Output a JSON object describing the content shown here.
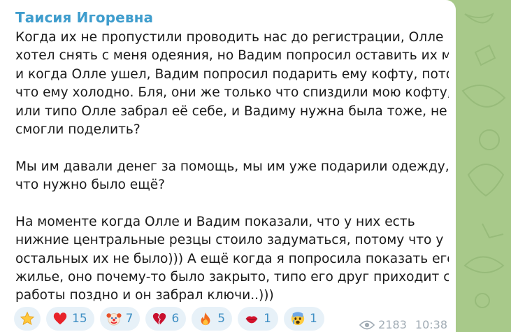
{
  "message": {
    "sender": "Таисия Игоревна",
    "lines": [
      "Когда их не пропустили проводить нас до регистрации, Олле",
      "хотел снять с меня одеяния, но Вадим попросил оставить их мне",
      "и когда Олле ушел, Вадим попросил подарить ему кофту, потому",
      "что ему холодно. Бля, они же только что спиздили мою кофту,",
      "или типо Олле забрал её себе, и Вадиму нужна была тоже, не",
      "смогли поделить?",
      "",
      "Мы им давали денег за помощь, мы им уже подарили одежду,",
      "что нужно было ещё?",
      "",
      "На моменте когда Олле и Вадим показали, что у них есть",
      "нижние центральные резцы стоило задуматься, потому что у",
      "остальных их не было))) А ещё когда я попросила показать его",
      "жилье, оно почему-то было закрыто, типо его друг приходит с",
      "работы поздно и он забрал ключи..)))"
    ],
    "views": "2183",
    "time": "10:38"
  },
  "reactions": [
    {
      "icon": "star-icon",
      "count": ""
    },
    {
      "icon": "heart-icon",
      "count": "15"
    },
    {
      "icon": "clown-icon",
      "count": "7"
    },
    {
      "icon": "broken-heart-icon",
      "count": "6"
    },
    {
      "icon": "fire-icon",
      "count": "5"
    },
    {
      "icon": "kiss-lips-icon",
      "count": "1"
    },
    {
      "icon": "crying-face-icon",
      "count": "1"
    }
  ],
  "colors": {
    "background": "#a8c98a",
    "bubble": "#ffffff",
    "sender": "#3f9dcd",
    "reaction_bg": "#e7f1f8",
    "reaction_count": "#3f8fc4",
    "meta": "#a0abb4"
  }
}
